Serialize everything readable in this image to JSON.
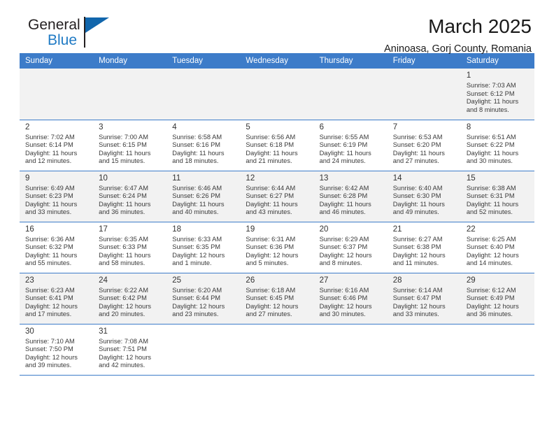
{
  "brand": {
    "name_part1": "General",
    "name_part2": "Blue",
    "mark": "triangle-logo"
  },
  "header": {
    "month_title": "March 2025",
    "location": "Aninoasa, Gorj County, Romania"
  },
  "accent_color": "#3d7cc9",
  "weekday_headers": [
    "Sunday",
    "Monday",
    "Tuesday",
    "Wednesday",
    "Thursday",
    "Friday",
    "Saturday"
  ],
  "labels": {
    "sunrise_prefix": "Sunrise:",
    "sunset_prefix": "Sunset:",
    "daylight_prefix": "Daylight:"
  },
  "weeks": [
    [
      {
        "blank": true
      },
      {
        "blank": true
      },
      {
        "blank": true
      },
      {
        "blank": true
      },
      {
        "blank": true
      },
      {
        "blank": true
      },
      {
        "day": "1",
        "sunrise": "Sunrise: 7:03 AM",
        "sunset": "Sunset: 6:12 PM",
        "daylight_line1": "Daylight: 11 hours",
        "daylight_line2": "and 8 minutes."
      }
    ],
    [
      {
        "day": "2",
        "sunrise": "Sunrise: 7:02 AM",
        "sunset": "Sunset: 6:14 PM",
        "daylight_line1": "Daylight: 11 hours",
        "daylight_line2": "and 12 minutes."
      },
      {
        "day": "3",
        "sunrise": "Sunrise: 7:00 AM",
        "sunset": "Sunset: 6:15 PM",
        "daylight_line1": "Daylight: 11 hours",
        "daylight_line2": "and 15 minutes."
      },
      {
        "day": "4",
        "sunrise": "Sunrise: 6:58 AM",
        "sunset": "Sunset: 6:16 PM",
        "daylight_line1": "Daylight: 11 hours",
        "daylight_line2": "and 18 minutes."
      },
      {
        "day": "5",
        "sunrise": "Sunrise: 6:56 AM",
        "sunset": "Sunset: 6:18 PM",
        "daylight_line1": "Daylight: 11 hours",
        "daylight_line2": "and 21 minutes."
      },
      {
        "day": "6",
        "sunrise": "Sunrise: 6:55 AM",
        "sunset": "Sunset: 6:19 PM",
        "daylight_line1": "Daylight: 11 hours",
        "daylight_line2": "and 24 minutes."
      },
      {
        "day": "7",
        "sunrise": "Sunrise: 6:53 AM",
        "sunset": "Sunset: 6:20 PM",
        "daylight_line1": "Daylight: 11 hours",
        "daylight_line2": "and 27 minutes."
      },
      {
        "day": "8",
        "sunrise": "Sunrise: 6:51 AM",
        "sunset": "Sunset: 6:22 PM",
        "daylight_line1": "Daylight: 11 hours",
        "daylight_line2": "and 30 minutes."
      }
    ],
    [
      {
        "day": "9",
        "sunrise": "Sunrise: 6:49 AM",
        "sunset": "Sunset: 6:23 PM",
        "daylight_line1": "Daylight: 11 hours",
        "daylight_line2": "and 33 minutes."
      },
      {
        "day": "10",
        "sunrise": "Sunrise: 6:47 AM",
        "sunset": "Sunset: 6:24 PM",
        "daylight_line1": "Daylight: 11 hours",
        "daylight_line2": "and 36 minutes."
      },
      {
        "day": "11",
        "sunrise": "Sunrise: 6:46 AM",
        "sunset": "Sunset: 6:26 PM",
        "daylight_line1": "Daylight: 11 hours",
        "daylight_line2": "and 40 minutes."
      },
      {
        "day": "12",
        "sunrise": "Sunrise: 6:44 AM",
        "sunset": "Sunset: 6:27 PM",
        "daylight_line1": "Daylight: 11 hours",
        "daylight_line2": "and 43 minutes."
      },
      {
        "day": "13",
        "sunrise": "Sunrise: 6:42 AM",
        "sunset": "Sunset: 6:28 PM",
        "daylight_line1": "Daylight: 11 hours",
        "daylight_line2": "and 46 minutes."
      },
      {
        "day": "14",
        "sunrise": "Sunrise: 6:40 AM",
        "sunset": "Sunset: 6:30 PM",
        "daylight_line1": "Daylight: 11 hours",
        "daylight_line2": "and 49 minutes."
      },
      {
        "day": "15",
        "sunrise": "Sunrise: 6:38 AM",
        "sunset": "Sunset: 6:31 PM",
        "daylight_line1": "Daylight: 11 hours",
        "daylight_line2": "and 52 minutes."
      }
    ],
    [
      {
        "day": "16",
        "sunrise": "Sunrise: 6:36 AM",
        "sunset": "Sunset: 6:32 PM",
        "daylight_line1": "Daylight: 11 hours",
        "daylight_line2": "and 55 minutes."
      },
      {
        "day": "17",
        "sunrise": "Sunrise: 6:35 AM",
        "sunset": "Sunset: 6:33 PM",
        "daylight_line1": "Daylight: 11 hours",
        "daylight_line2": "and 58 minutes."
      },
      {
        "day": "18",
        "sunrise": "Sunrise: 6:33 AM",
        "sunset": "Sunset: 6:35 PM",
        "daylight_line1": "Daylight: 12 hours",
        "daylight_line2": "and 1 minute."
      },
      {
        "day": "19",
        "sunrise": "Sunrise: 6:31 AM",
        "sunset": "Sunset: 6:36 PM",
        "daylight_line1": "Daylight: 12 hours",
        "daylight_line2": "and 5 minutes."
      },
      {
        "day": "20",
        "sunrise": "Sunrise: 6:29 AM",
        "sunset": "Sunset: 6:37 PM",
        "daylight_line1": "Daylight: 12 hours",
        "daylight_line2": "and 8 minutes."
      },
      {
        "day": "21",
        "sunrise": "Sunrise: 6:27 AM",
        "sunset": "Sunset: 6:38 PM",
        "daylight_line1": "Daylight: 12 hours",
        "daylight_line2": "and 11 minutes."
      },
      {
        "day": "22",
        "sunrise": "Sunrise: 6:25 AM",
        "sunset": "Sunset: 6:40 PM",
        "daylight_line1": "Daylight: 12 hours",
        "daylight_line2": "and 14 minutes."
      }
    ],
    [
      {
        "day": "23",
        "sunrise": "Sunrise: 6:23 AM",
        "sunset": "Sunset: 6:41 PM",
        "daylight_line1": "Daylight: 12 hours",
        "daylight_line2": "and 17 minutes."
      },
      {
        "day": "24",
        "sunrise": "Sunrise: 6:22 AM",
        "sunset": "Sunset: 6:42 PM",
        "daylight_line1": "Daylight: 12 hours",
        "daylight_line2": "and 20 minutes."
      },
      {
        "day": "25",
        "sunrise": "Sunrise: 6:20 AM",
        "sunset": "Sunset: 6:44 PM",
        "daylight_line1": "Daylight: 12 hours",
        "daylight_line2": "and 23 minutes."
      },
      {
        "day": "26",
        "sunrise": "Sunrise: 6:18 AM",
        "sunset": "Sunset: 6:45 PM",
        "daylight_line1": "Daylight: 12 hours",
        "daylight_line2": "and 27 minutes."
      },
      {
        "day": "27",
        "sunrise": "Sunrise: 6:16 AM",
        "sunset": "Sunset: 6:46 PM",
        "daylight_line1": "Daylight: 12 hours",
        "daylight_line2": "and 30 minutes."
      },
      {
        "day": "28",
        "sunrise": "Sunrise: 6:14 AM",
        "sunset": "Sunset: 6:47 PM",
        "daylight_line1": "Daylight: 12 hours",
        "daylight_line2": "and 33 minutes."
      },
      {
        "day": "29",
        "sunrise": "Sunrise: 6:12 AM",
        "sunset": "Sunset: 6:49 PM",
        "daylight_line1": "Daylight: 12 hours",
        "daylight_line2": "and 36 minutes."
      }
    ],
    [
      {
        "day": "30",
        "sunrise": "Sunrise: 7:10 AM",
        "sunset": "Sunset: 7:50 PM",
        "daylight_line1": "Daylight: 12 hours",
        "daylight_line2": "and 39 minutes."
      },
      {
        "day": "31",
        "sunrise": "Sunrise: 7:08 AM",
        "sunset": "Sunset: 7:51 PM",
        "daylight_line1": "Daylight: 12 hours",
        "daylight_line2": "and 42 minutes."
      },
      {
        "blank": true
      },
      {
        "blank": true
      },
      {
        "blank": true
      },
      {
        "blank": true
      },
      {
        "blank": true
      }
    ]
  ]
}
